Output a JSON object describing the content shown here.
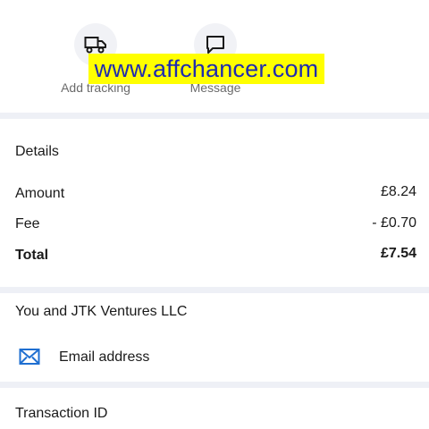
{
  "actions": [
    {
      "label": "Add tracking",
      "icon": "truck-icon"
    },
    {
      "label": "Message",
      "icon": "message-icon"
    }
  ],
  "watermark": "www.affchancer.com",
  "details": {
    "title": "Details",
    "rows": [
      {
        "label": "Amount",
        "value": "£8.24"
      },
      {
        "label": "Fee",
        "value": "- £0.70"
      },
      {
        "label": "Total",
        "value": "£7.54"
      }
    ]
  },
  "contact": {
    "title": "You and JTK Ventures LLC",
    "email_label": "Email address",
    "email_icon": "mail-icon"
  },
  "transaction": {
    "title": "Transaction ID"
  },
  "colors": {
    "icon_blue": "#1f6fd1",
    "watermark_bg": "#ffff00",
    "watermark_text": "#1f2bb0",
    "divider": "#eef0f6"
  }
}
